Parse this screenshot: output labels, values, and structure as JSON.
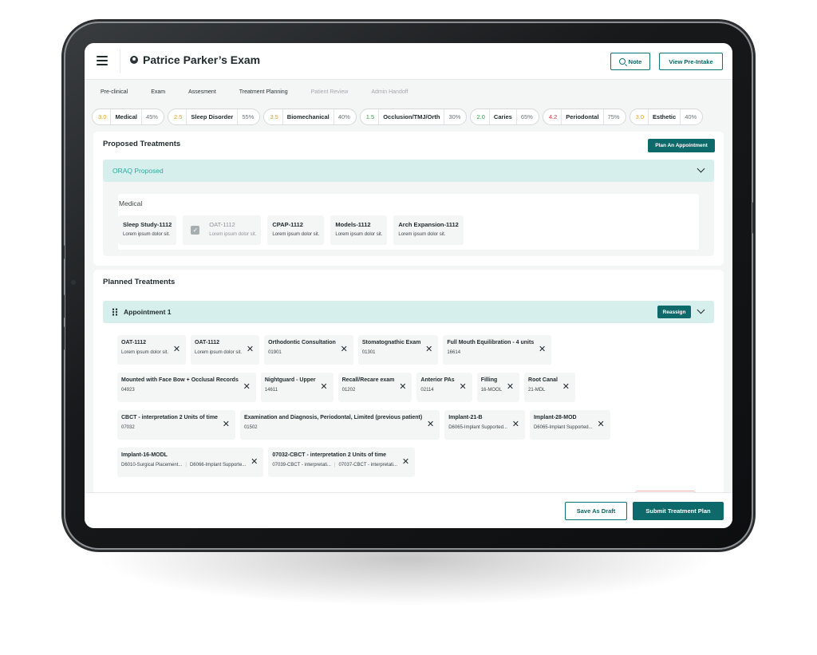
{
  "header": {
    "title": "Patrice Parker’s Exam",
    "note_label": "Note",
    "preintake_label": "View Pre-Intake"
  },
  "tabs": [
    {
      "label": "Pre-clinical",
      "active": true
    },
    {
      "label": "Exam",
      "active": true
    },
    {
      "label": "Assesment",
      "active": true
    },
    {
      "label": "Treatment Planning",
      "active": true
    },
    {
      "label": "Patient Review",
      "active": false
    },
    {
      "label": "Admin Handoff",
      "active": false
    }
  ],
  "risks": [
    {
      "score": "3.0",
      "name": "Medical",
      "pct": "45%",
      "color": "#e8a21a"
    },
    {
      "score": "2.5",
      "name": "Sleep Disorder",
      "pct": "55%",
      "color": "#e8a21a"
    },
    {
      "score": "3.5",
      "name": "Biomechanical",
      "pct": "40%",
      "color": "#e8a21a"
    },
    {
      "score": "1.5",
      "name": "Occlusion/TMJ/Orth",
      "pct": "30%",
      "color": "#3aa34a"
    },
    {
      "score": "2.0",
      "name": "Caries",
      "pct": "65%",
      "color": "#3aa34a"
    },
    {
      "score": "4.2",
      "name": "Periodontal",
      "pct": "75%",
      "color": "#d93a3a"
    },
    {
      "score": "3.0",
      "name": "Esthetic",
      "pct": "40%",
      "color": "#e8a21a"
    }
  ],
  "proposed": {
    "title": "Proposed Treatments",
    "plan_label": "Plan An Appointment",
    "oraq_label": "ORAQ Proposed",
    "group_label": "Medical",
    "items": [
      {
        "title": "Sleep Study-1112",
        "sub": "Lorem ipsum dolor sit.",
        "muted": false,
        "checked": false
      },
      {
        "title": "OAT-1112",
        "sub": "Lorem ipsum dolor sit.",
        "muted": true,
        "checked": true
      },
      {
        "title": "CPAP-1112",
        "sub": "Lorem ipsum dolor sit.",
        "muted": false,
        "checked": false
      },
      {
        "title": "Models-1112",
        "sub": "Lorem ipsum dolor sit.",
        "muted": false,
        "checked": false
      },
      {
        "title": "Arch Expansion-1112",
        "sub": "Lorem ipsum dolor sit.",
        "muted": false,
        "checked": false
      }
    ]
  },
  "planned": {
    "title": "Planned Treatments",
    "appointment_label": "Appointment 1",
    "reassign_label": "Reassign",
    "rows": [
      [
        {
          "title": "OAT-1112",
          "sub": [
            "Lorem ipsum dolor sit."
          ]
        },
        {
          "title": "OAT-1112",
          "sub": [
            "Lorem ipsum dolor sit."
          ]
        },
        {
          "title": "Orthodontic Consultation",
          "sub": [
            "01901"
          ]
        },
        {
          "title": "Stomatognathic Exam",
          "sub": [
            "01301"
          ]
        },
        {
          "title": "Full Mouth Equilibration - 4 units",
          "sub": [
            "16614"
          ]
        }
      ],
      [
        {
          "title": "Mounted with Face Bow + Occlusal Records",
          "sub": [
            "04923"
          ]
        },
        {
          "title": "Nightguard - Upper",
          "sub": [
            "14611"
          ]
        },
        {
          "title": "Recall/Recare exam",
          "sub": [
            "01202"
          ]
        },
        {
          "title": "Anterior PAs",
          "sub": [
            "02114"
          ]
        },
        {
          "title": "Filling",
          "sub": [
            "16-MOOL"
          ]
        },
        {
          "title": "Root Canal",
          "sub": [
            "21-MDL"
          ]
        }
      ],
      [
        {
          "title": "CBCT - interpretation 2 Units of time",
          "sub": [
            "07032"
          ]
        },
        {
          "title": "Examination and Diagnosis, Periodontal, Limited (previous patient)",
          "sub": [
            "01502"
          ]
        },
        {
          "title": "Implant-21-B",
          "sub": [
            "D6065-Implant Supported..."
          ]
        },
        {
          "title": "Implant-28-MOD",
          "sub": [
            "D6065-Implant Supported..."
          ]
        }
      ],
      [
        {
          "title": "Implant-16-MODL",
          "sub": [
            "D6010-Surgical Placement...",
            "D6066-Implant Supporte..."
          ]
        },
        {
          "title": "07032-CBCT - interpretation 2 Units of time",
          "sub": [
            "07039-CBCT - interpretati...",
            "07037-CBCT - interpretati..."
          ]
        }
      ]
    ]
  },
  "footer": {
    "draft_label": "Save As Draft",
    "submit_label": "Submit Treatment Plan"
  },
  "colors": {
    "accent": "#0e6a6a",
    "accordion_bg": "#d6efec",
    "oraq_text": "#30a8a0"
  },
  "icons": {
    "menu": "hamburger-icon",
    "user": "user-icon",
    "note": "search-icon",
    "chevron": "chevron-down-icon",
    "drag": "drag-handle-icon",
    "remove": "close-icon",
    "check": "checkbox-icon"
  }
}
